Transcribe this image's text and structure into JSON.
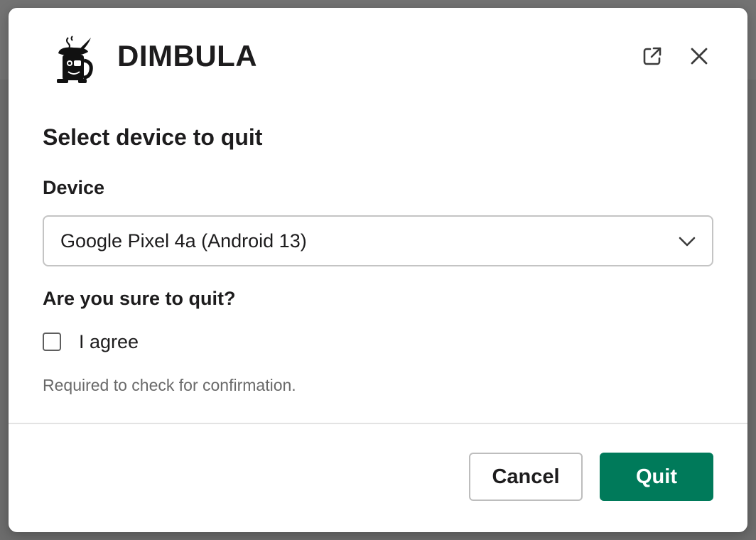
{
  "app": {
    "name": "DIMBULA",
    "logo_icon": "pirate-coffee-mug-logo"
  },
  "header": {
    "open_external_icon": "external-link-icon",
    "close_icon": "close-icon"
  },
  "form": {
    "title": "Select device to quit",
    "device_label": "Device",
    "device_value": "Google Pixel 4a (Android 13)",
    "question": "Are you sure to quit?",
    "agree_label": "I agree",
    "agree_checked": false,
    "hint": "Required to check for confirmation."
  },
  "footer": {
    "cancel_label": "Cancel",
    "quit_label": "Quit"
  },
  "colors": {
    "primary": "#007a5a",
    "text": "#1d1c1d",
    "hint": "#696969",
    "border": "#c4c4c4"
  }
}
